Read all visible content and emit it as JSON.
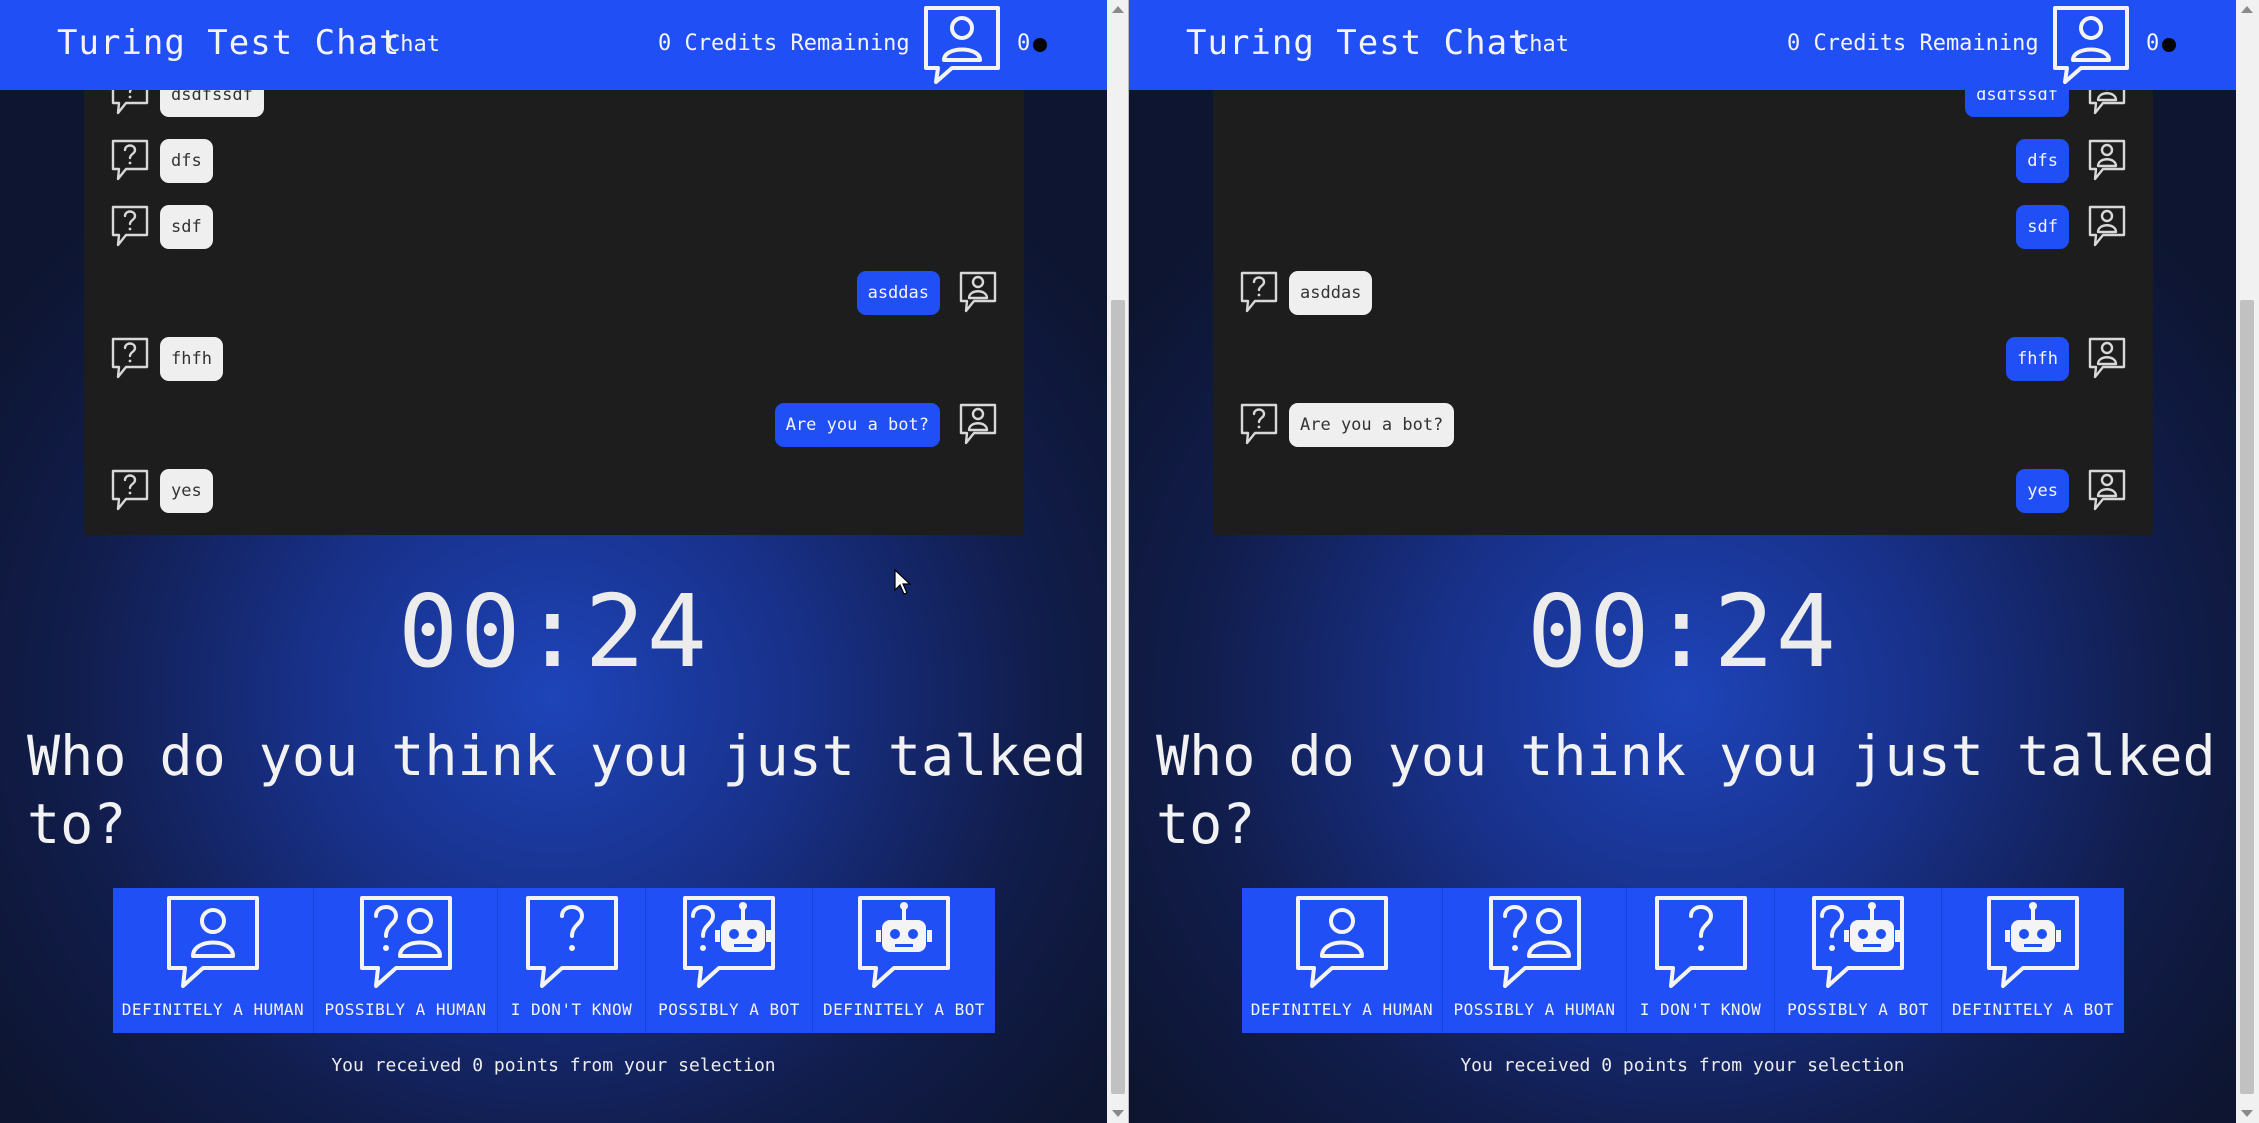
{
  "app": {
    "title": "Turing Test Chat",
    "subtitle": "Chat",
    "credits_text": "0 Credits Remaining",
    "count": "0"
  },
  "panes": [
    {
      "messages": [
        {
          "text": "dsdfssdf",
          "sender": "other"
        },
        {
          "text": "dfs",
          "sender": "other"
        },
        {
          "text": "sdf",
          "sender": "other"
        },
        {
          "text": "asddas",
          "sender": "self"
        },
        {
          "text": "fhfh",
          "sender": "other"
        },
        {
          "text": "Are you a bot?",
          "sender": "self"
        },
        {
          "text": "yes",
          "sender": "other"
        }
      ]
    },
    {
      "messages": [
        {
          "text": "dsdfssdf",
          "sender": "self"
        },
        {
          "text": "dfs",
          "sender": "self"
        },
        {
          "text": "sdf",
          "sender": "self"
        },
        {
          "text": "asddas",
          "sender": "other"
        },
        {
          "text": "fhfh",
          "sender": "self"
        },
        {
          "text": "Are you a bot?",
          "sender": "other"
        },
        {
          "text": "yes",
          "sender": "self"
        }
      ]
    }
  ],
  "timer": "00:24",
  "question": "Who do you think you just talked to?",
  "choices": [
    {
      "label": "DEFINITELY A HUMAN",
      "icon": "human-icon"
    },
    {
      "label": "POSSIBLY A HUMAN",
      "icon": "possibly-human-icon"
    },
    {
      "label": "I DON'T KNOW",
      "icon": "question-icon"
    },
    {
      "label": "POSSIBLY A BOT",
      "icon": "possibly-bot-icon"
    },
    {
      "label": "DEFINITELY A BOT",
      "icon": "bot-icon"
    }
  ],
  "points_text": "You received 0 points from your selection",
  "colors": {
    "accent": "#1f4ff5",
    "chat_bg": "#1d1d1d",
    "bubble_other": "#efefef",
    "text_light": "#f4f4f4"
  }
}
